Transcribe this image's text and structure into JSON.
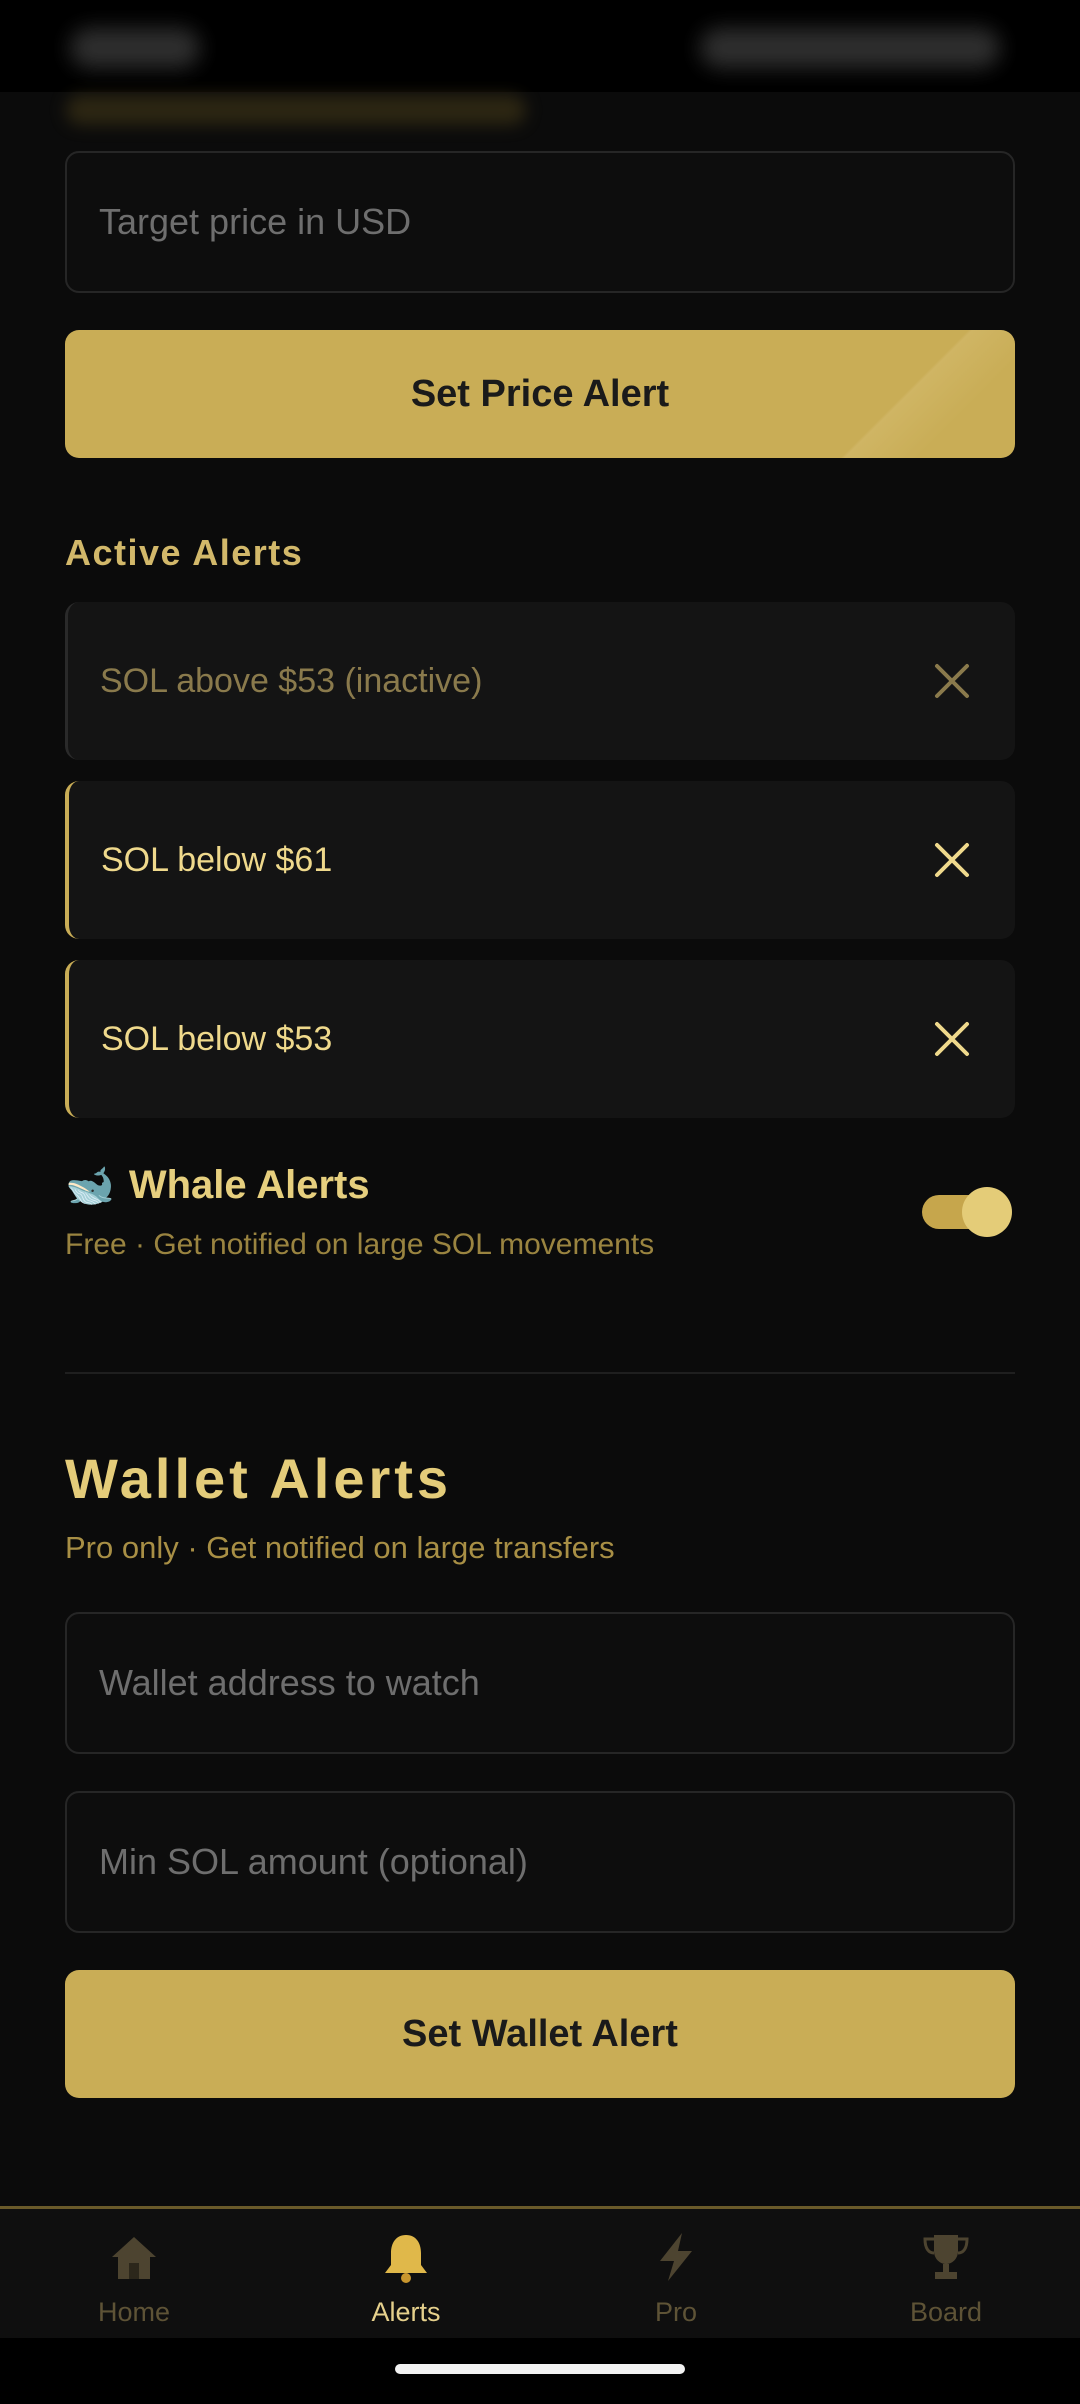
{
  "price_alert": {
    "target_placeholder": "Target price in USD",
    "button_label": "Set Price Alert"
  },
  "active_alerts": {
    "label": "Active Alerts",
    "items": [
      {
        "text": "SOL above $53 (inactive)",
        "active": false
      },
      {
        "text": "SOL below $61",
        "active": true
      },
      {
        "text": "SOL below $53",
        "active": true
      }
    ]
  },
  "whale_alerts": {
    "icon": "🐋",
    "title": "Whale Alerts",
    "subtitle": "Free · Get notified on large SOL movements",
    "enabled": true
  },
  "wallet_alerts": {
    "title": "Wallet Alerts",
    "subtitle": "Pro only · Get notified on large transfers",
    "address_placeholder": "Wallet address to watch",
    "min_amount_placeholder": "Min SOL amount (optional)",
    "button_label": "Set Wallet Alert"
  },
  "nav": {
    "items": [
      {
        "label": "Home",
        "icon": "home-icon",
        "active": false
      },
      {
        "label": "Alerts",
        "icon": "bell-icon",
        "active": true
      },
      {
        "label": "Pro",
        "icon": "lightning-icon",
        "active": false
      },
      {
        "label": "Board",
        "icon": "trophy-icon",
        "active": false
      }
    ]
  },
  "colors": {
    "accent": "#c9ad56",
    "background": "#0b0b0b",
    "card": "#141414"
  }
}
